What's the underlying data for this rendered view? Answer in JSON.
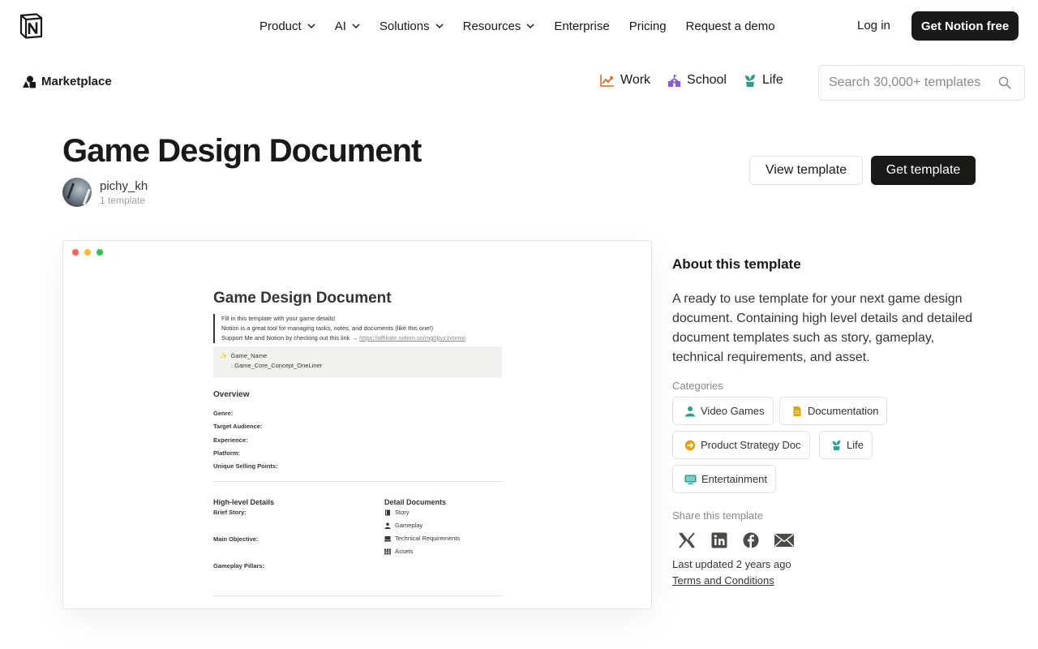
{
  "nav": {
    "items": [
      {
        "label": "Product",
        "dropdown": true
      },
      {
        "label": "AI",
        "dropdown": true
      },
      {
        "label": "Solutions",
        "dropdown": true
      },
      {
        "label": "Resources",
        "dropdown": true
      },
      {
        "label": "Enterprise",
        "dropdown": false
      },
      {
        "label": "Pricing",
        "dropdown": false
      },
      {
        "label": "Request a demo",
        "dropdown": false
      }
    ],
    "login": "Log in",
    "cta": "Get Notion free"
  },
  "marketplace": {
    "label": "Marketplace",
    "categories": [
      {
        "label": "Work",
        "icon": "chart-up-icon",
        "color": "#e16a16"
      },
      {
        "label": "School",
        "icon": "school-building-icon",
        "color": "#8d5bd6"
      },
      {
        "label": "Life",
        "icon": "plant-icon",
        "color": "#2a9d8f"
      }
    ],
    "search_placeholder": "Search 30,000+ templates"
  },
  "template": {
    "title": "Game Design Document",
    "author": "pichy_kh",
    "author_count": "1 template",
    "view_button": "View template",
    "get_button": "Get template"
  },
  "preview": {
    "doc_title": "Game Design Document",
    "quote_lines": [
      "Fill in this template with your game details!",
      "Notion is a great tool for managing tasks, notes, and documents (like this one!)",
      "Support Me and Notion by checking out this link →"
    ],
    "quote_link": "https://affiliate.notion.so/mg0pvz1vomxl",
    "callout_icon": "✨",
    "callout_line1": "Game_Name",
    "callout_line2": ": Game_Core_Concept_OneLiner",
    "overview_heading": "Overview",
    "overview_fields": [
      "Genre:",
      "Target Audience:",
      "Experience:",
      "Platform:",
      "Unique Selling Points:"
    ],
    "high_level_heading": "High-level Details",
    "high_level_fields": [
      "Brief Story:",
      "Main Objective:",
      "Gameplay Pillars:"
    ],
    "detail_heading": "Detail Documents",
    "detail_docs": [
      {
        "label": "Story",
        "icon": "book-icon"
      },
      {
        "label": "Gameplay",
        "icon": "person-icon"
      },
      {
        "label": "Technical Requirements",
        "icon": "computer-icon"
      },
      {
        "label": "Assets",
        "icon": "grid-icon"
      }
    ]
  },
  "about": {
    "heading": "About this template",
    "description": "A ready to use template for your next game design document. Containing high level details and detailed document templates such as story, gameplay, technical requirements, and asset.",
    "categories_label": "Categories",
    "categories": [
      {
        "label": "Video Games",
        "icon": "person-icon",
        "color": "#2a9d8f"
      },
      {
        "label": "Documentation",
        "icon": "document-icon",
        "color": "#e0a30a"
      },
      {
        "label": "Product Strategy Doc",
        "icon": "arrow-circle-icon",
        "color": "#e0a30a"
      },
      {
        "label": "Life",
        "icon": "plant-icon",
        "color": "#2a9d8f"
      },
      {
        "label": "Entertainment",
        "icon": "tv-icon",
        "color": "#2a9d8f"
      }
    ],
    "share_label": "Share this template",
    "share_icons": [
      "x-icon",
      "linkedin-icon",
      "facebook-icon",
      "email-icon"
    ],
    "last_updated": "Last updated 2 years ago",
    "terms": "Terms and Conditions"
  }
}
